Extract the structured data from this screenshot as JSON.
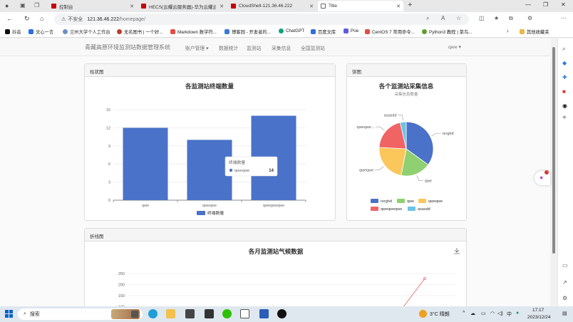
{
  "browser": {
    "tabs": [
      {
        "title": "控制台",
        "active": false
      },
      {
        "title": "HECS(云耀云服务器)-华为云耀云",
        "active": false
      },
      {
        "title": "CloudShell-121.36.46.222",
        "active": false
      },
      {
        "title": "Title",
        "active": true
      }
    ],
    "new_tab": "+",
    "address": {
      "warning": "⚠",
      "insecure_label": "不安全",
      "host": "121.36.46.222",
      "path": "/homepage/"
    },
    "bookmarks": [
      {
        "label": "抖音",
        "color": "#111111"
      },
      {
        "label": "文心一言",
        "color": "#2b6de5"
      },
      {
        "label": "兰州大学个人工作台",
        "color": "#6b8fc6"
      },
      {
        "label": "无名图书 | 一个好...",
        "color": "#c0392b"
      },
      {
        "label": "Markdown 数学符...",
        "color": "#e54d42"
      },
      {
        "label": "博客园 - 开发者的...",
        "color": "#3a7bd5"
      },
      {
        "label": "ChatGPT",
        "color": "#10a37f"
      },
      {
        "label": "百度文库",
        "color": "#2f6fe0"
      },
      {
        "label": "Poe",
        "color": "#5d5cde"
      },
      {
        "label": "CentOS 7 常用命令...",
        "color": "#e54d42"
      },
      {
        "label": "Python3 教程 | 菜鸟...",
        "color": "#5aa02c"
      }
    ],
    "bookmarks_folder": "其他收藏夹"
  },
  "navbar": {
    "brand": "青藏高原环境监测站数据管理系统",
    "items": [
      "账户管理 ▾",
      "数据统计",
      "监测站",
      "采集信息",
      "全国监测站"
    ],
    "user": "qwe ▾"
  },
  "panels": {
    "bar": {
      "heading": "柱状图",
      "title": "各监测站终端数量"
    },
    "pie": {
      "heading": "饼图",
      "title": "各个监测站采集信息",
      "subtitle": "采集信息数量"
    },
    "line": {
      "heading": "折线图",
      "title": "各月监测站气候数据"
    }
  },
  "tooltip": {
    "title": "终端数量",
    "name": "qweqwe",
    "value": "14"
  },
  "chart_data": [
    {
      "type": "bar",
      "title": "各监测站终端数量",
      "categories": [
        "qwe",
        "qweqwe",
        "qweqweqwe"
      ],
      "series": [
        {
          "name": "终端数量",
          "values": [
            12,
            10,
            14
          ]
        }
      ],
      "ylim": [
        0,
        15
      ],
      "yticks": [
        0,
        3,
        6,
        9,
        12,
        15
      ],
      "grid": true,
      "legend": "bottom",
      "color": "#4a72c9"
    },
    {
      "type": "pie",
      "title": "各个监测站采集信息",
      "subtitle": "采集信息数量",
      "slices": [
        {
          "name": "rerghd",
          "value": 29,
          "color": "#4a72c9"
        },
        {
          "name": "qwe",
          "value": 15,
          "color": "#8fd071"
        },
        {
          "name": "qweqwe",
          "value": 19,
          "color": "#fbc75a"
        },
        {
          "name": "qweqweqwe",
          "value": 17,
          "color": "#f06464"
        },
        {
          "name": "asasdd",
          "value": 3,
          "color": "#6cc3e3"
        }
      ],
      "legend": "bottom"
    },
    {
      "type": "line",
      "title": "各月监测站气候数据",
      "yticks": [
        100,
        150,
        200,
        250
      ],
      "grid": true
    }
  ],
  "taskbar": {
    "search_label": "搜索",
    "weather": "3°C 晴朗",
    "ime": "中",
    "time": "17:17",
    "date": "2023/12/24"
  }
}
